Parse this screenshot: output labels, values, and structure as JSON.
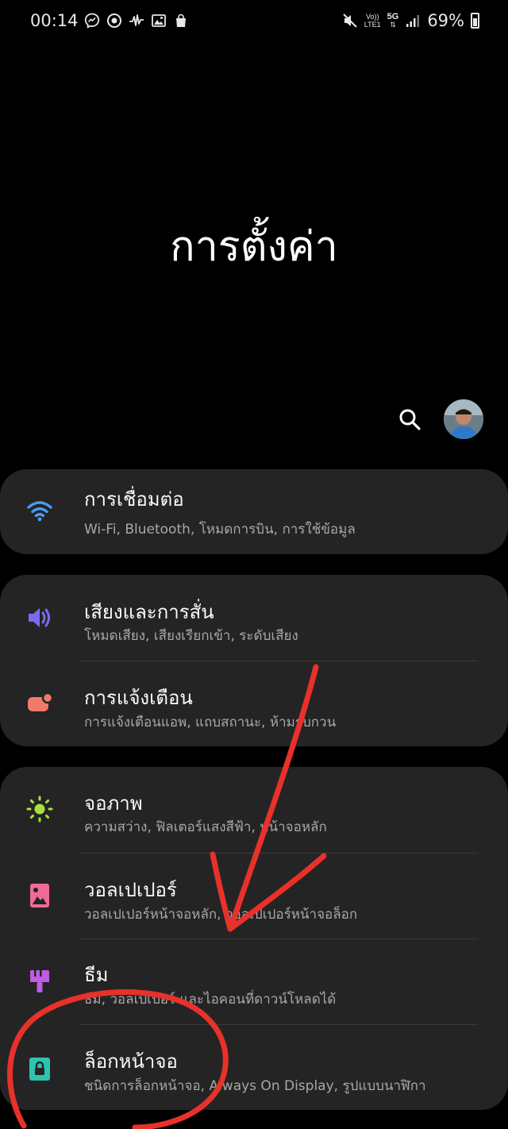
{
  "status_bar": {
    "time": "00:14",
    "left_icons": [
      "messenger-icon",
      "target-icon",
      "pulse-icon",
      "image-icon",
      "bag-icon"
    ],
    "volte_line1": "Vo))",
    "volte_line2": "LTE1",
    "network": "5G",
    "battery": "69%",
    "battery_level": 0.69
  },
  "title": "การตั้งค่า",
  "colors": {
    "background": "#000000",
    "card": "#242424",
    "wifi": "#4a9cf0",
    "sound": "#7a6cf0",
    "notifications": "#f07a6a",
    "display": "#a8e040",
    "wallpaper": "#f06a9a",
    "themes": "#c05ae8",
    "lockscreen": "#2cc4b0",
    "annotation": "#e8312a"
  },
  "groups": [
    {
      "items": [
        {
          "icon": "wifi-icon",
          "title": "การเชื่อมต่อ",
          "subtitle": "Wi-Fi, Bluetooth, โหมดการบิน, การใช้ข้อมูล"
        }
      ]
    },
    {
      "items": [
        {
          "icon": "volume-icon",
          "title": "เสียงและการสั่น",
          "subtitle": "โหมดเสียง, เสียงเรียกเข้า, ระดับเสียง"
        },
        {
          "icon": "notification-icon",
          "title": "การแจ้งเตือน",
          "subtitle": "การแจ้งเตือนแอพ, แถบสถานะ, ห้ามรบกวน"
        }
      ]
    },
    {
      "items": [
        {
          "icon": "brightness-icon",
          "title": "จอภาพ",
          "subtitle": "ความสว่าง, ฟิลเตอร์แสงสีฟ้า, หน้าจอหลัก"
        },
        {
          "icon": "wallpaper-icon",
          "title": "วอลเปเปอร์",
          "subtitle": "วอลเปเปอร์หน้าจอหลัก, วอลเปเปอร์หน้าจอล็อก"
        },
        {
          "icon": "theme-brush-icon",
          "title": "ธีม",
          "subtitle": "ธีม, วอลเปเปอร์ และไอคอนที่ดาวน์โหลดได้"
        },
        {
          "icon": "lock-icon",
          "title": "ล็อกหน้าจอ",
          "subtitle": "ชนิดการล็อกหน้าจอ, Always On Display, รูปแบบนาฬิกา"
        }
      ]
    }
  ]
}
